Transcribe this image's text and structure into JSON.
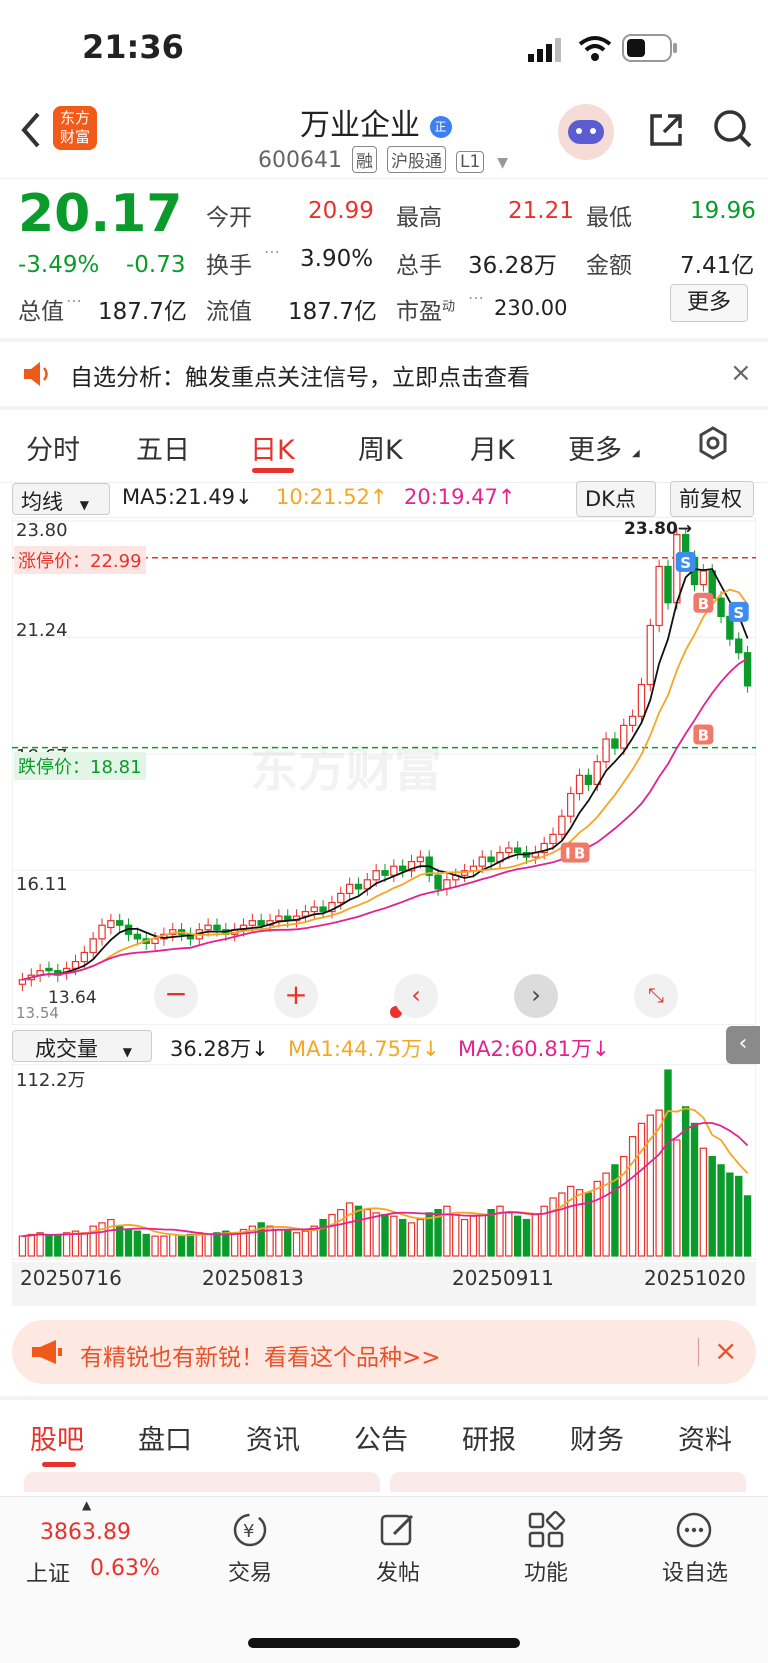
{
  "status": {
    "time": "21:36"
  },
  "header": {
    "logo_text": [
      "东方",
      "财富"
    ],
    "title": "万业企业",
    "title_badge": "正",
    "code": "600641",
    "tags": [
      "融",
      "沪股通",
      "L1"
    ]
  },
  "quote": {
    "price": "20.17",
    "change_pct": "-3.49%",
    "change": "-0.73",
    "rows": [
      [
        {
          "label": "今开",
          "value": "20.99",
          "color": "red"
        },
        {
          "label": "最高",
          "value": "21.21",
          "color": "red"
        },
        {
          "label": "最低",
          "value": "19.96",
          "color": "green"
        }
      ],
      [
        {
          "label": "换手",
          "value": "3.90%",
          "color": "default"
        },
        {
          "label": "总手",
          "value": "36.28万",
          "color": "default"
        },
        {
          "label": "金额",
          "value": "7.41亿",
          "color": "default"
        }
      ],
      [
        {
          "label": "流值",
          "value": "187.7亿",
          "color": "default"
        },
        {
          "label": "市盈",
          "label_sup": "动",
          "value": "230.00",
          "color": "default"
        }
      ]
    ],
    "total_value_label": "总值",
    "total_value": "187.7亿",
    "more_button": "更多"
  },
  "alert": {
    "text": "自选分析：触发重点关注信号，立即点击查看"
  },
  "chart_tabs": {
    "items": [
      "分时",
      "五日",
      "日K",
      "周K",
      "月K",
      "更多"
    ],
    "active": "日K"
  },
  "indicator_bar": {
    "type_select": "均线",
    "ma5": "MA5:21.49↓",
    "ma10": "10:21.52↑",
    "ma20": "20:19.47↑",
    "dk_select": "DK点",
    "adjust_button": "前复权"
  },
  "price_panel": {
    "y_labels": [
      "23.80",
      "21.24",
      "18.67",
      "16.11"
    ],
    "limit_up_label": "涨停价：22.99",
    "limit_down_label": "跌停价：18.81",
    "high_marker": "23.80→",
    "low_marker": "13.64",
    "watermark": "东方财富",
    "bottom_left_label": "13.54",
    "signals": [
      "S",
      "B",
      "S",
      "B",
      "B",
      "B"
    ],
    "colors": {
      "up": "#e8322b",
      "down": "#0a9b2b",
      "ma5": "#111111",
      "ma10": "#f5a623",
      "ma20": "#e0238f"
    }
  },
  "volume_bar": {
    "select": "成交量",
    "value": "36.28万↓",
    "ma1": "MA1:44.75万↓",
    "ma2": "MA2:60.81万↓",
    "y_max": "112.2万"
  },
  "x_axis": [
    "20250716",
    "20250813",
    "20250911",
    "20251020"
  ],
  "promo": {
    "text": "有精锐也有新锐！看看这个品种>>"
  },
  "bottom_tabs": {
    "items": [
      "股吧",
      "盘口",
      "资讯",
      "公告",
      "研报",
      "财务",
      "资料"
    ],
    "active": "股吧"
  },
  "bottom_nav": {
    "index_value": "3863.89",
    "index_name": "上证",
    "index_change": "0.63%",
    "items": [
      {
        "label": "交易",
        "icon": "yen-cycle-icon"
      },
      {
        "label": "发帖",
        "icon": "edit-icon"
      },
      {
        "label": "功能",
        "icon": "grid-icon"
      },
      {
        "label": "设自选",
        "icon": "more-circle-icon"
      }
    ]
  },
  "chart_data": [
    {
      "type": "candlestick",
      "title": "",
      "x_range": [
        "20250716",
        "20251022"
      ],
      "ylim": [
        13.54,
        23.8
      ],
      "ma_values": {
        "MA5": 21.49,
        "MA10": 21.52,
        "MA20": 19.47
      },
      "x_tick_labels": [
        "20250716",
        "20250813",
        "20250911",
        "20251020"
      ],
      "closes": [
        13.7,
        13.8,
        13.9,
        13.9,
        13.8,
        13.95,
        14.1,
        14.3,
        14.6,
        14.9,
        15.0,
        14.9,
        14.7,
        14.6,
        14.5,
        14.6,
        14.7,
        14.8,
        14.7,
        14.6,
        14.8,
        14.9,
        14.8,
        14.7,
        14.8,
        14.9,
        15.0,
        14.9,
        15.0,
        15.1,
        15.0,
        15.1,
        15.2,
        15.3,
        15.2,
        15.4,
        15.6,
        15.8,
        15.7,
        15.9,
        16.1,
        16.0,
        16.2,
        16.1,
        16.3,
        16.4,
        16.0,
        15.7,
        15.9,
        16.0,
        16.1,
        16.2,
        16.4,
        16.3,
        16.5,
        16.6,
        16.5,
        16.4,
        16.5,
        16.7,
        16.9,
        17.3,
        17.8,
        18.2,
        18.0,
        18.5,
        19.0,
        18.8,
        19.3,
        19.5,
        20.2,
        21.5,
        22.8,
        22.0,
        23.5,
        23.0,
        22.4,
        22.7,
        22.1,
        21.7,
        21.2,
        20.9,
        20.17
      ],
      "opens": [
        13.6,
        13.7,
        13.8,
        13.95,
        13.9,
        13.85,
        13.95,
        14.1,
        14.3,
        14.6,
        14.85,
        15.0,
        14.9,
        14.7,
        14.6,
        14.5,
        14.6,
        14.7,
        14.8,
        14.7,
        14.6,
        14.8,
        14.9,
        14.8,
        14.7,
        14.8,
        14.9,
        15.0,
        14.9,
        15.0,
        15.1,
        15.0,
        15.1,
        15.2,
        15.3,
        15.2,
        15.4,
        15.6,
        15.8,
        15.7,
        15.9,
        16.1,
        16.0,
        16.2,
        16.1,
        16.3,
        16.4,
        16.0,
        15.7,
        15.9,
        16.0,
        16.1,
        16.2,
        16.4,
        16.3,
        16.5,
        16.6,
        16.5,
        16.4,
        16.5,
        16.7,
        16.9,
        17.3,
        17.8,
        18.2,
        18.0,
        18.5,
        19.0,
        18.8,
        19.3,
        19.5,
        20.2,
        21.5,
        22.8,
        22.0,
        23.5,
        23.0,
        22.4,
        22.7,
        22.1,
        21.7,
        21.2,
        20.9
      ]
    },
    {
      "type": "bar",
      "title": "成交量",
      "ylabel": "",
      "ylim": [
        0,
        112.2
      ],
      "unit": "万",
      "values": [
        12,
        13,
        14,
        12,
        13,
        14,
        15,
        14,
        18,
        20,
        22,
        18,
        16,
        15,
        13,
        12,
        12,
        13,
        12,
        13,
        14,
        13,
        14,
        15,
        14,
        16,
        18,
        20,
        18,
        16,
        15,
        14,
        15,
        18,
        22,
        25,
        28,
        32,
        30,
        28,
        26,
        25,
        24,
        22,
        20,
        22,
        26,
        28,
        30,
        25,
        22,
        24,
        25,
        28,
        30,
        26,
        24,
        22,
        25,
        30,
        35,
        38,
        42,
        40,
        38,
        45,
        50,
        55,
        60,
        72,
        80,
        85,
        88,
        112.2,
        70,
        90,
        80,
        65,
        60,
        55,
        50,
        48,
        36.28
      ],
      "ma1": 44.75,
      "ma2": 60.81
    }
  ]
}
